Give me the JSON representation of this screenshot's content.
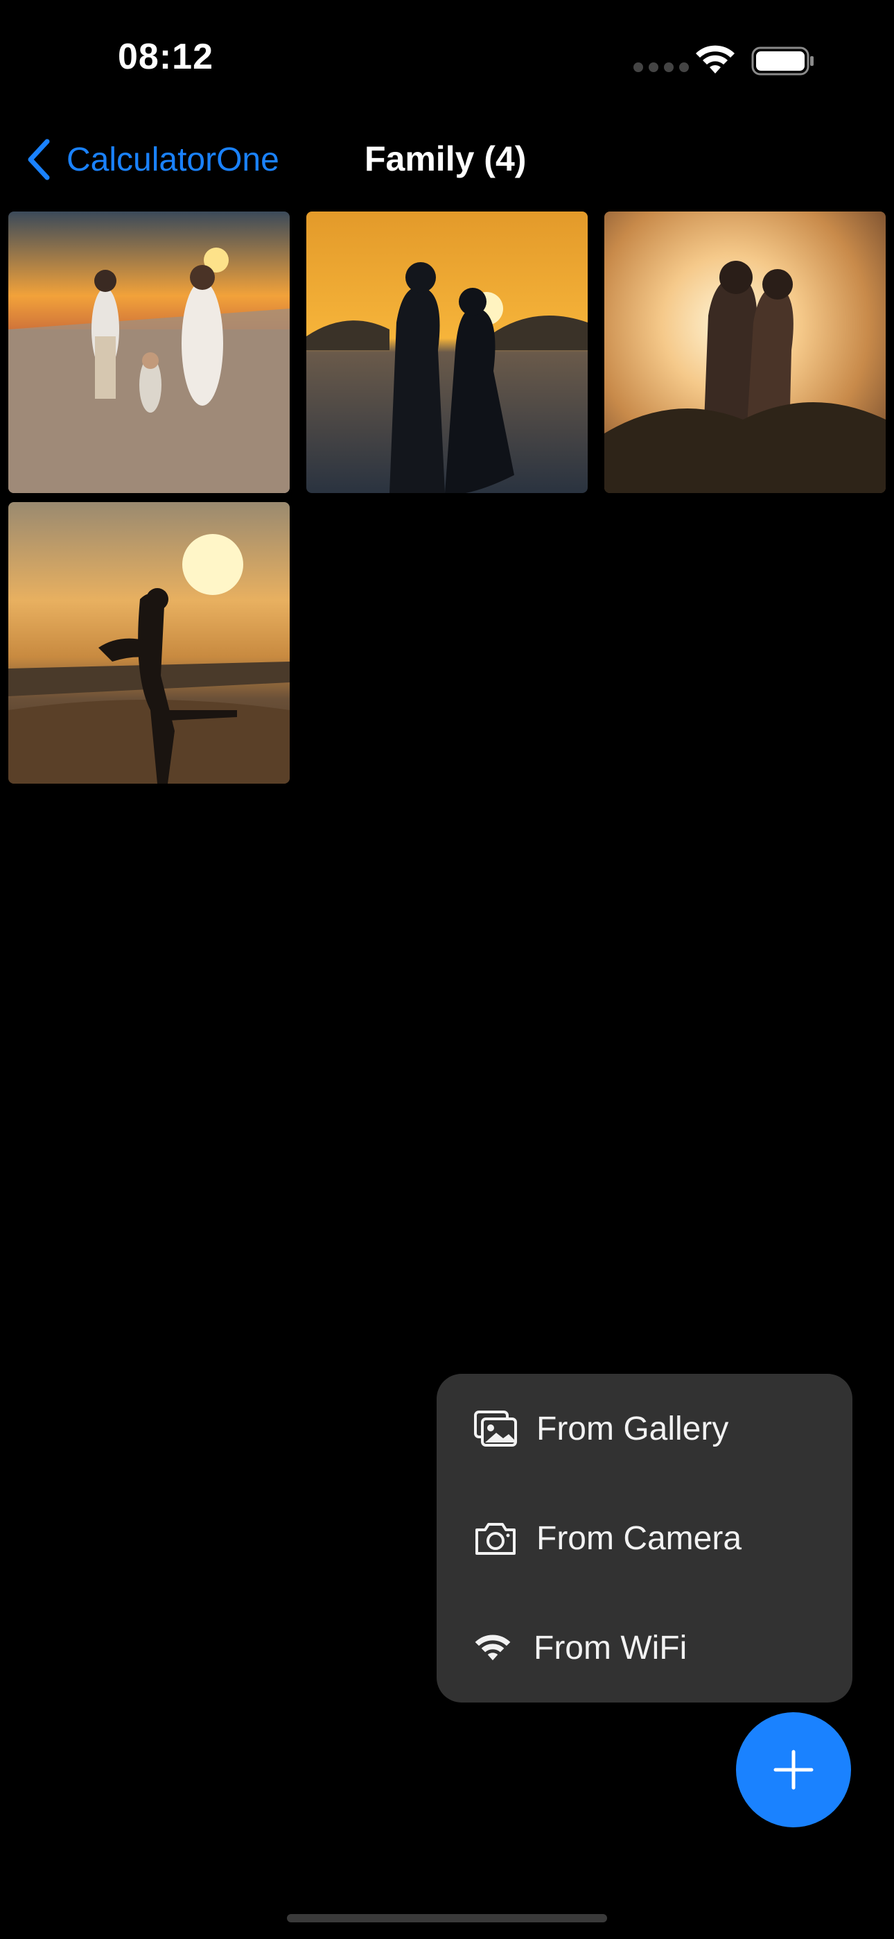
{
  "status_bar": {
    "time": "08:12"
  },
  "nav": {
    "back_label": "CalculatorOne",
    "title": "Family (4)"
  },
  "photos": [
    {
      "description": "family walking on beach at sunset"
    },
    {
      "description": "couple silhouette by the sea"
    },
    {
      "description": "couple embracing in sunlight"
    },
    {
      "description": "woman leaping into partner's arms at sunset"
    }
  ],
  "menu": {
    "items": [
      {
        "label": "From Gallery",
        "icon": "gallery-icon"
      },
      {
        "label": "From Camera",
        "icon": "camera-icon"
      },
      {
        "label": "From WiFi",
        "icon": "wifi-icon"
      }
    ]
  },
  "colors": {
    "accent": "#1a82ff",
    "menu_bg": "#323232",
    "background": "#000000"
  }
}
